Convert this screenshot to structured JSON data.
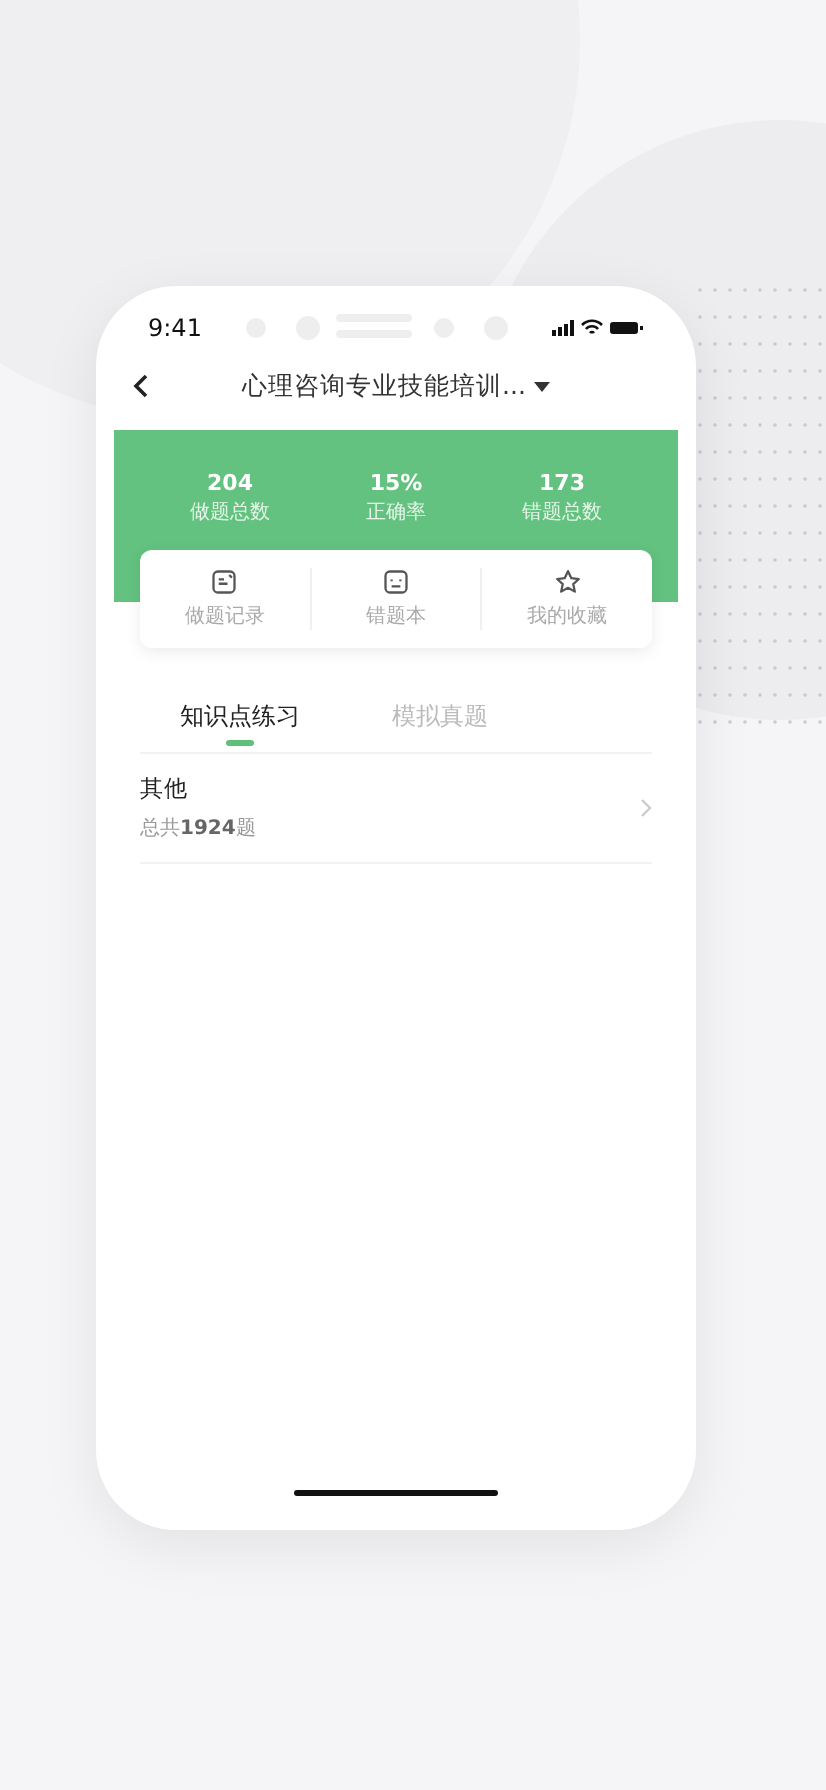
{
  "status_bar": {
    "time": "9:41"
  },
  "nav": {
    "title": "心理咨询专业技能培训..."
  },
  "stats": [
    {
      "value": "204",
      "label": "做题总数"
    },
    {
      "value": "15%",
      "label": "正确率"
    },
    {
      "value": "173",
      "label": "错题总数"
    }
  ],
  "shortcuts": [
    {
      "label": "做题记录",
      "kind": "record"
    },
    {
      "label": "错题本",
      "kind": "mistakes"
    },
    {
      "label": "我的收藏",
      "kind": "favorite"
    }
  ],
  "tabs": [
    {
      "label": "知识点练习",
      "selected": true
    },
    {
      "label": "模拟真题",
      "selected": false
    }
  ],
  "items": [
    {
      "title": "其他",
      "subtitle": "总共**1924**题"
    }
  ]
}
